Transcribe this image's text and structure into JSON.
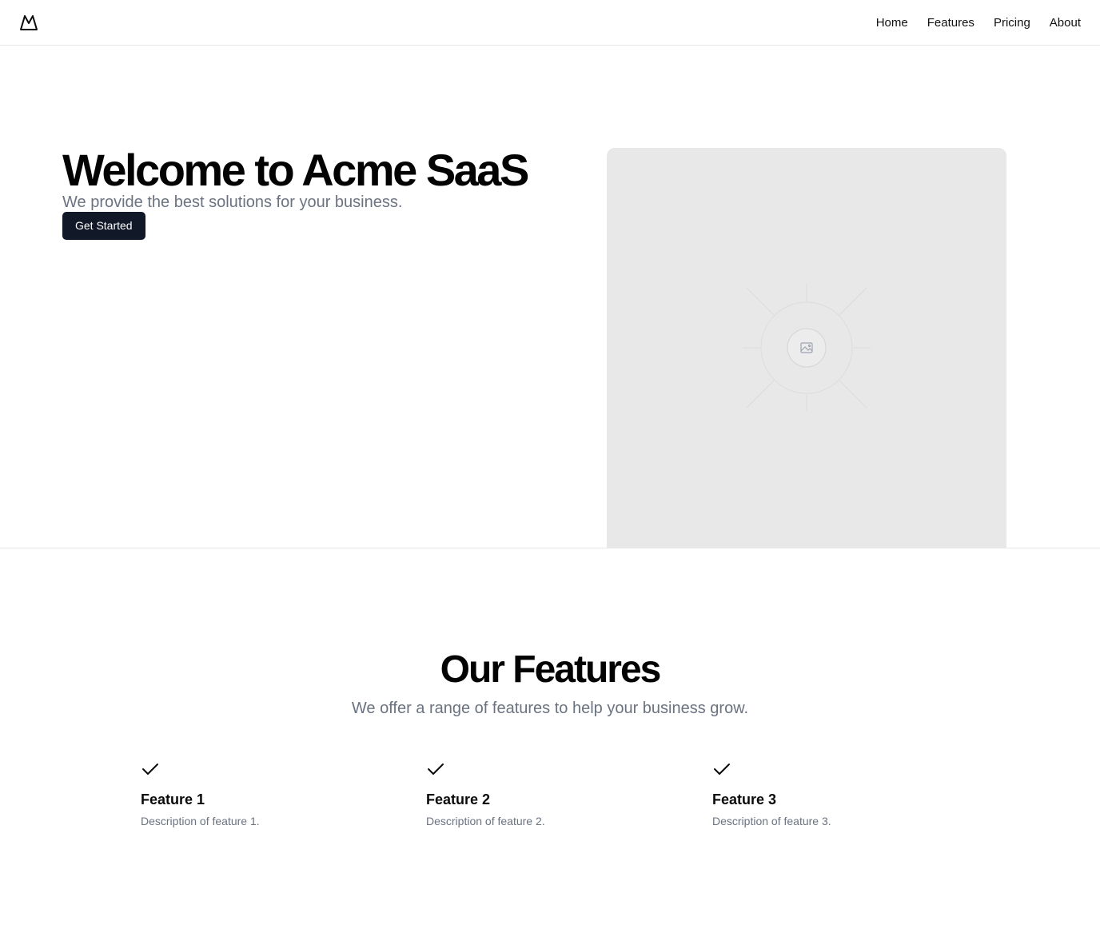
{
  "header": {
    "logo_icon": "mountain-logo-icon",
    "nav": [
      {
        "label": "Home"
      },
      {
        "label": "Features"
      },
      {
        "label": "Pricing"
      },
      {
        "label": "About"
      }
    ]
  },
  "hero": {
    "title": "Welcome to Acme SaaS",
    "subtitle": "We provide the best solutions for your business.",
    "cta_label": "Get Started",
    "image_icon": "image-placeholder-icon",
    "image_bg": "#e8e8e8"
  },
  "features": {
    "title": "Our Features",
    "subtitle": "We offer a range of features to help your business grow.",
    "items": [
      {
        "icon": "check-icon",
        "title": "Feature 1",
        "description": "Description of feature 1."
      },
      {
        "icon": "check-icon",
        "title": "Feature 2",
        "description": "Description of feature 2."
      },
      {
        "icon": "check-icon",
        "title": "Feature 3",
        "description": "Description of feature 3."
      }
    ]
  },
  "colors": {
    "primary_button": "#111827",
    "muted_text": "#6b7280",
    "border": "#e5e7eb"
  }
}
